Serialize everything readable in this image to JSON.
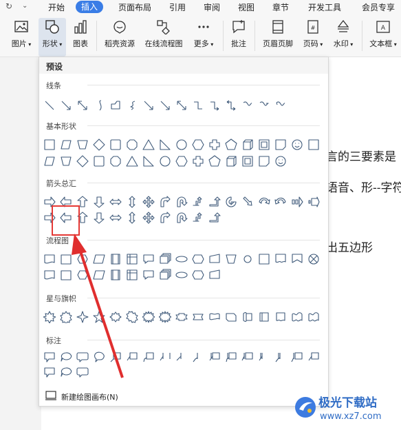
{
  "menubar": {
    "tabs": [
      {
        "label": "开始"
      },
      {
        "label": "插入"
      },
      {
        "label": "页面布局"
      },
      {
        "label": "引用"
      },
      {
        "label": "审阅"
      },
      {
        "label": "视图"
      },
      {
        "label": "章节"
      },
      {
        "label": "开发工具"
      },
      {
        "label": "会员专享"
      }
    ],
    "active_tab": "插入",
    "accent_color": "#3a7de6"
  },
  "ribbon": {
    "buttons": [
      {
        "label": "图片",
        "icon": "picture-icon"
      },
      {
        "label": "形状",
        "icon": "shapes-icon"
      },
      {
        "label": "图表",
        "icon": "chart-icon"
      },
      {
        "label": "稻壳资源",
        "icon": "resource-icon"
      },
      {
        "label": "在线流程图",
        "icon": "flowchart-icon"
      },
      {
        "label": "更多",
        "icon": "more-icon"
      },
      {
        "label": "批注",
        "icon": "comment-icon"
      },
      {
        "label": "页眉页脚",
        "icon": "header-footer-icon"
      },
      {
        "label": "页码",
        "icon": "page-number-icon"
      },
      {
        "label": "水印",
        "icon": "watermark-icon"
      },
      {
        "label": "文本框",
        "icon": "textbox-icon"
      }
    ]
  },
  "document": {
    "lines": [
      "言的三要素是",
      "语音、形--字符",
      "出五边形"
    ]
  },
  "shapes_panel": {
    "header": "预设",
    "sections": [
      {
        "title": "线条"
      },
      {
        "title": "基本形状"
      },
      {
        "title": "箭头总汇"
      },
      {
        "title": "流程图"
      },
      {
        "title": "星与旗帜"
      },
      {
        "title": "标注"
      }
    ],
    "new_canvas_label": "新建绘图画布(N)",
    "shape_color": "#3f5a7a",
    "highlight_color": "#e53935"
  },
  "watermark": {
    "text": "极光下载站",
    "url": "www.xz7.com"
  }
}
